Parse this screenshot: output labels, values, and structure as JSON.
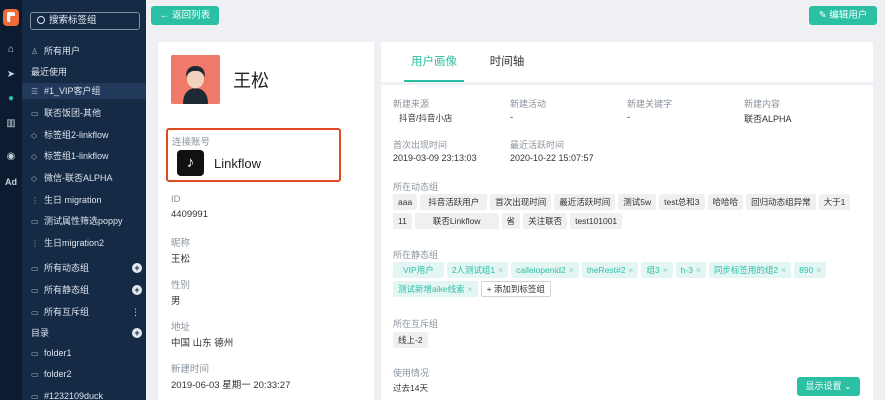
{
  "rail": {
    "icons": [
      "home-icon",
      "send-icon",
      "user-icon",
      "chart-icon",
      "wechat-icon",
      "ad-icon"
    ],
    "ad_label": "Ad"
  },
  "sidebar": {
    "search_placeholder": "搜索标签组",
    "all_users": "所有用户",
    "frequent_header": "最近使用",
    "frequent": [
      "#1_VIP客户组",
      "联否饭团-其他",
      "标签组2-linkflow",
      "标签组1-linkflow",
      "微信-联否ALPHA",
      "生日 migration",
      "测试属性筛选poppy",
      "生日migration2"
    ],
    "dynamic_groups": "所有动态组",
    "static_groups": "所有静态组",
    "mutex_groups": "所有互斥组",
    "dir_header": "目录",
    "folders": [
      "folder1",
      "folder2",
      "#1232109duck"
    ]
  },
  "header": {
    "back_label": "返回列表",
    "edit_label": "编辑用户"
  },
  "profile": {
    "name": "王松",
    "connected_label": "连接账号",
    "connected_account": "Linkflow",
    "id_label": "ID",
    "id_value": "4409991",
    "nickname_label": "昵称",
    "nickname_value": "王松",
    "gender_label": "性别",
    "gender_value": "男",
    "address_label": "地址",
    "address_value": "中国 山东 德州",
    "created_label": "新建时间",
    "created_value": "2019-06-03 星期一 20:33:27"
  },
  "tabs": [
    "用户画像",
    "时间轴"
  ],
  "portrait": {
    "source_label": "新建来源",
    "source_value": "抖音/抖音小店",
    "activity_label": "新建活动",
    "activity_value": "-",
    "keyword_label": "新建关键字",
    "keyword_value": "-",
    "content_label": "新建内容",
    "content_value": "联否ALPHA",
    "first_seen_label": "首次出现时间",
    "first_seen_value": "2019-03-09 23:13:03",
    "last_active_label": "最近活跃时间",
    "last_active_value": "2020-10-22 15:07:57",
    "dynamic_label": "所在动态组",
    "dynamic_tags": [
      "aaa",
      "抖音活跃用户",
      "首次出现时间",
      "最近活跃时间",
      "测试5w",
      "test总和3",
      "哈哈哈",
      "回归动态组异常",
      "大于1",
      "11",
      "联否Linkflow",
      "省",
      "关注联否",
      "test101001"
    ],
    "static_label": "所在静态组",
    "static_tags": [
      "VIP用户",
      "2人测试组1",
      "caileiopenid2",
      "theRest#2",
      "组3",
      "h-3",
      "同步标签用的组2",
      "890",
      "测试新增aike线索"
    ],
    "add_tag_label": "添加到标签组",
    "mutex_label": "所在互斥组",
    "mutex_tags": [
      "线上-2"
    ],
    "usage_label": "使用情况",
    "usage_value": "过去14天",
    "display_settings_label": "显示设置"
  },
  "colors": {
    "accent": "#2bbfa4",
    "sidebar_bg": "#152a45",
    "rail_bg": "#0d1b30",
    "highlight_border": "#e04a1f"
  }
}
